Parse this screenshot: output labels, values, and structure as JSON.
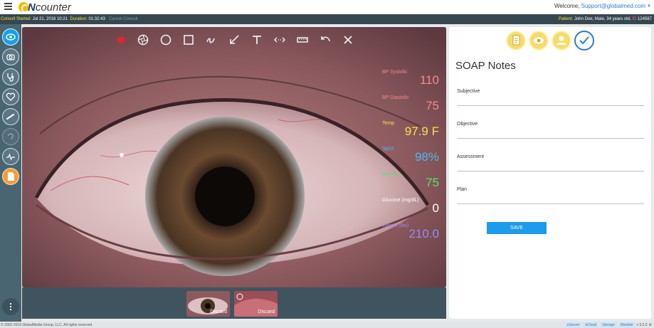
{
  "app": {
    "logo_e": "e",
    "logo_n": "N",
    "logo_rest": "counter",
    "welcome_prefix": "Welcome, ",
    "welcome_user": "Support@globalmed.com"
  },
  "consult": {
    "started_label": "Consult Started:",
    "started_value": "Jul 21, 2016 10:21",
    "duration_label": "Duration:",
    "duration_value": "01:32:43",
    "cancel_label": "Cancel Consult",
    "patient_label": "Patient:",
    "patient_value": "John Doe, Male, 34 years old,",
    "id_label": "ID",
    "id_value": "124567"
  },
  "nav": {
    "items": [
      "eye-camera",
      "otoscope",
      "stethoscope",
      "heart",
      "scope",
      "ear",
      "ekg",
      "notes"
    ]
  },
  "toolbar": {
    "tools": [
      "record",
      "shutter",
      "circle",
      "square",
      "freehand",
      "arrow",
      "text",
      "measure",
      "ruler",
      "undo",
      "close"
    ]
  },
  "vitals": [
    {
      "label": "BP Systolic",
      "value": "110",
      "color": "#f08b8b"
    },
    {
      "label": "BP Diastolic",
      "value": "75",
      "color": "#f08b8b"
    },
    {
      "label": "Temp",
      "value": "97.9 F",
      "color": "#f3e24b"
    },
    {
      "label": "Sp02",
      "value": "98%",
      "color": "#4fb8ef"
    },
    {
      "label": "HR ♥/m",
      "value": "75",
      "color": "#5ee06a"
    },
    {
      "label": "Glucose (mg/dL)",
      "value": "0",
      "color": "#ffffff"
    },
    {
      "label": "Weight (lbs)",
      "value": "210.0",
      "color": "#9b8af0"
    }
  ],
  "thumbs": [
    {
      "label": "Discard"
    },
    {
      "label": "Discard"
    }
  ],
  "soap": {
    "title": "SOAP Notes",
    "fields": [
      "Subjective",
      "Objective",
      "Assessment",
      "Plan"
    ],
    "save_label": "SAVE"
  },
  "footer": {
    "copyright": "© 2002-2016 GlobalMedia Group, LLC. All rights reserved.",
    "links": [
      "eServer",
      "eCloud",
      "Storage",
      "Worklist"
    ],
    "version": "v 3.2.0"
  },
  "colors": {
    "accent": "#1aa0e6",
    "infobar": "#37474f",
    "nav": "#4a6572"
  }
}
